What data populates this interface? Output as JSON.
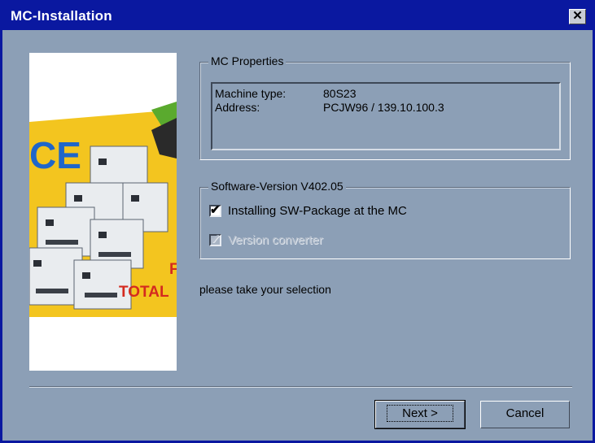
{
  "window": {
    "title": "MC-Installation",
    "close_glyph": "✕"
  },
  "image": {
    "banner_text_1": "CE",
    "banner_text_2": "TOTAL",
    "banner_text_3": "F"
  },
  "mc_properties": {
    "label": "MC Properties",
    "rows": [
      {
        "label": "Machine type:",
        "value": "80S23"
      },
      {
        "label": "Address:",
        "value": "PCJW96 / 139.10.100.3"
      }
    ]
  },
  "software": {
    "label": "Software-Version V402.05",
    "install_label": "Installing SW-Package at the MC",
    "install_checked": true,
    "converter_label": "Version converter",
    "converter_checked": true,
    "converter_disabled": true
  },
  "hint": "please take your selection",
  "buttons": {
    "next": "Next >",
    "cancel": "Cancel"
  },
  "colors": {
    "titlebar": "#0a18a0",
    "dialog": "#8c9fb6"
  }
}
